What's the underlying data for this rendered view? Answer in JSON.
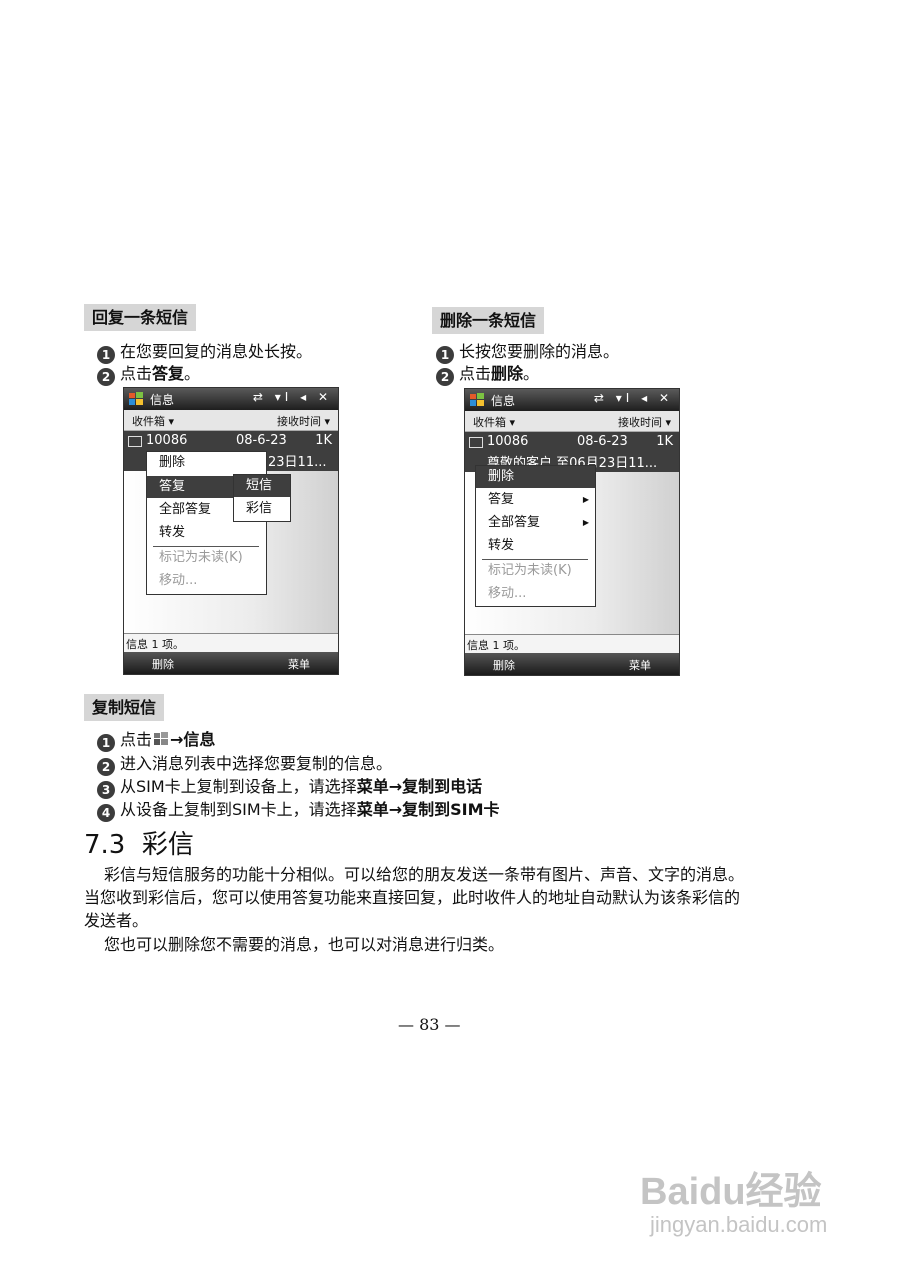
{
  "sections": {
    "reply": {
      "label": "回复一条短信",
      "steps": [
        {
          "num": "1",
          "text": "在您要回复的消息处长按。"
        },
        {
          "num": "2",
          "text_before": "点击",
          "bold": "答复",
          "text_after": "。"
        }
      ]
    },
    "delete": {
      "label": "删除一条短信",
      "steps": [
        {
          "num": "1",
          "text": "长按您要删除的消息。"
        },
        {
          "num": "2",
          "text_before": "点击",
          "bold": "删除",
          "text_after": "。"
        }
      ]
    },
    "copy": {
      "label": "复制短信",
      "steps": [
        {
          "num": "1",
          "text_before": "点击",
          "arrow": "→",
          "bold": "信息"
        },
        {
          "num": "2",
          "text": "进入消息列表中选择您要复制的信息。"
        },
        {
          "num": "3",
          "text_before": "从SIM卡上复制到设备上，请选择",
          "bold1": "菜单",
          "arrow": "→",
          "bold2": "复制到电话"
        },
        {
          "num": "4",
          "text_before": "从设备上复制到SIM卡上，请选择",
          "bold1": "菜单",
          "arrow": "→",
          "bold2": "复制到",
          "text_after": "SIM卡"
        }
      ]
    }
  },
  "phone_left": {
    "title": "信息",
    "status_icons": "⇄ ▾ⵏ ◂ ✕",
    "folder": "收件箱 ▾",
    "sort": "接收时间 ▾",
    "item": {
      "sender": "10086",
      "date": "08-6-23",
      "size": "1K",
      "preview": "23日11..."
    },
    "menu": [
      "删除",
      "答复",
      "全部答复",
      "转发",
      "标记为未读(K)",
      "移动..."
    ],
    "submenu": [
      "短信",
      "彩信"
    ],
    "status": "信息  1 项。",
    "soft_left": "删除",
    "soft_right": "菜单"
  },
  "phone_right": {
    "title": "信息",
    "status_icons": "⇄ ▾ⵏ ◂ ✕",
    "folder": "收件箱 ▾",
    "sort": "接收时间 ▾",
    "item": {
      "sender": "10086",
      "date": "08-6-23",
      "size": "1K",
      "preview": "尊敬的客户,至06月23日11..."
    },
    "menu": [
      "删除",
      "答复",
      "全部答复",
      "转发",
      "标记为未读(K)",
      "移动..."
    ],
    "status": "信息  1 项。",
    "soft_left": "删除",
    "soft_right": "菜单"
  },
  "mms": {
    "heading": "7.3  彩信",
    "para1_line1": "彩信与短信服务的功能十分相似。可以给您的朋友发送一条带有图片、声音、文字的消息。",
    "para1_line2": "当您收到彩信后，您可以使用答复功能来直接回复，此时收件人的地址自动默认为该条彩信的",
    "para1_line3": "发送者。",
    "para2": "您也可以删除您不需要的消息，也可以对消息进行归类。"
  },
  "page_number": "— 83 —",
  "watermark": {
    "brand": "Baidu经验",
    "url": "jingyan.baidu.com"
  }
}
